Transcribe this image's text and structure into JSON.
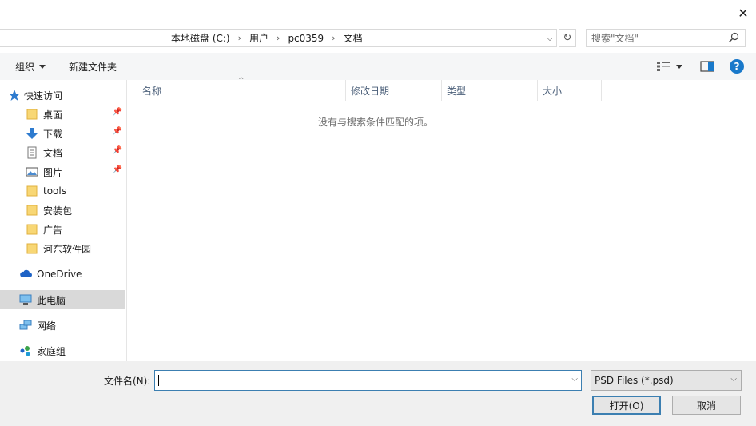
{
  "window": {
    "close_glyph": "✕"
  },
  "address": {
    "crumbs": [
      "本地磁盘 (C:)",
      "用户",
      "pc0359",
      "文档"
    ],
    "separator": "›",
    "dropdown_glyph": "⌵",
    "refresh_glyph": "↻"
  },
  "search": {
    "placeholder": "搜索\"文档\""
  },
  "toolbar": {
    "organize_label": "组织",
    "new_folder_label": "新建文件夹",
    "help_label": "?"
  },
  "nav": {
    "quick_access": "快速访问",
    "items": [
      {
        "label": "桌面",
        "icon": "folder-icon",
        "pinned": true
      },
      {
        "label": "下载",
        "icon": "download-icon",
        "pinned": true
      },
      {
        "label": "文档",
        "icon": "document-icon",
        "pinned": true
      },
      {
        "label": "图片",
        "icon": "picture-icon",
        "pinned": true
      },
      {
        "label": "tools",
        "icon": "folder-icon",
        "pinned": false
      },
      {
        "label": "安装包",
        "icon": "folder-icon",
        "pinned": false
      },
      {
        "label": "广告",
        "icon": "folder-icon",
        "pinned": false
      },
      {
        "label": "河东软件园",
        "icon": "folder-icon",
        "pinned": false
      }
    ],
    "onedrive": "OneDrive",
    "this_pc": "此电脑",
    "network": "网络",
    "homegroup": "家庭组"
  },
  "columns": {
    "name": "名称",
    "modified": "修改日期",
    "type": "类型",
    "size": "大小"
  },
  "empty_message": "没有与搜索条件匹配的项。",
  "bottom": {
    "filename_label": "文件名(N):",
    "filename_value": "",
    "filetype_value": "PSD Files (*.psd)",
    "open_label": "打开(O)",
    "cancel_label": "取消"
  },
  "colors": {
    "accent": "#1979ca",
    "selected_bg": "#d9d9d9",
    "toolbar_bg": "#f5f6f7",
    "bottom_bg": "#f0f0f0"
  }
}
